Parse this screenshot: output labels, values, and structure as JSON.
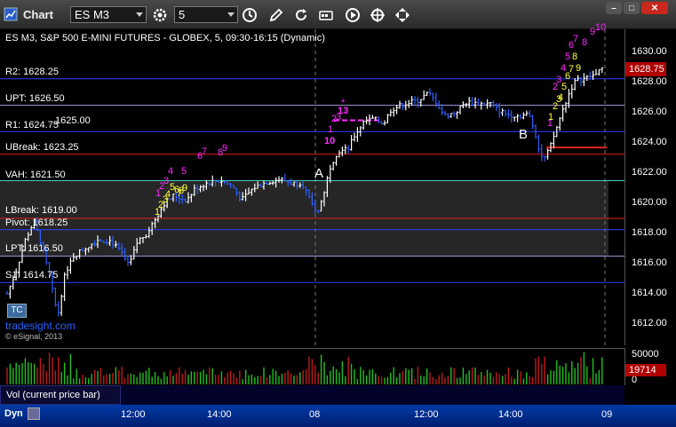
{
  "toolbar": {
    "chart_label": "Chart",
    "symbol": "ES M3",
    "interval": "5",
    "icons": [
      "settings-gear-icon",
      "clock-icon",
      "pencil-icon",
      "refresh-icon",
      "indicator-icon",
      "play-icon",
      "crosshair-icon",
      "move-icon"
    ],
    "window_buttons": [
      "minimize-icon",
      "maximize-icon",
      "close-icon"
    ]
  },
  "title": "ES M3, S&P 500 E-MINI FUTURES - GLOBEX, 5, 09:30-16:15 (Dynamic)",
  "price_axis": {
    "ticks": [
      "1630.00",
      "1628.00",
      "1626.00",
      "1624.00",
      "1622.00",
      "1620.00",
      "1618.00",
      "1616.00",
      "1614.00",
      "1612.00"
    ],
    "last_price": "1628.75"
  },
  "levels": [
    {
      "label": "R2: 1628.25",
      "color": "#2f3fff"
    },
    {
      "label": "UPT: 1626.50",
      "color": "#9b8fd0"
    },
    {
      "label": "R1: 1624.75",
      "color": "#2f3fff"
    },
    {
      "label": "UBreak: 1623.25",
      "color": "#e02020"
    },
    {
      "label": "VAH: 1621.50",
      "color": "#40d0c0"
    },
    {
      "label": "LBreak: 1619.00",
      "color": "#e02020"
    },
    {
      "label": "Pivot: 1618.25",
      "color": "#2f3fff"
    },
    {
      "label": "LPT: 1616.50",
      "color": "#9b8fd0"
    },
    {
      "label": "S1: 1614.75",
      "color": "#2f3fff"
    }
  ],
  "overlap_label": "1625.00",
  "annotations": {
    "a": "A",
    "b": "B"
  },
  "markers_magenta": [
    "1",
    "2",
    "3",
    "4",
    "5",
    "6",
    "7",
    "8",
    "9",
    "1",
    "2",
    "3",
    "10",
    "13",
    "*",
    "1",
    "2",
    "3",
    "4",
    "5",
    "6",
    "7",
    "8",
    "9",
    "10"
  ],
  "markers_yellow": [
    "1",
    "2",
    "3",
    "4",
    "5",
    "6",
    "7",
    "8",
    "9",
    "1",
    "2",
    "3",
    "4",
    "5",
    "6",
    "7",
    "8",
    "9"
  ],
  "watermark": {
    "site": "tradesight.com",
    "copyright": "© eSignal, 2013"
  },
  "volume": {
    "label": "Vol (current price bar)",
    "ticks": [
      "50000",
      "0"
    ],
    "last": "19714"
  },
  "time_axis": {
    "dyn_label": "Dyn",
    "ticks": [
      "12:00",
      "14:00",
      "08",
      "12:00",
      "14:00",
      "09"
    ]
  },
  "colors": {
    "up_bar": "#ffffff",
    "down_bar": "#2f5fff",
    "magenta": "#ff2cff",
    "yellow": "#ffff40",
    "value_area": "#222222"
  }
}
